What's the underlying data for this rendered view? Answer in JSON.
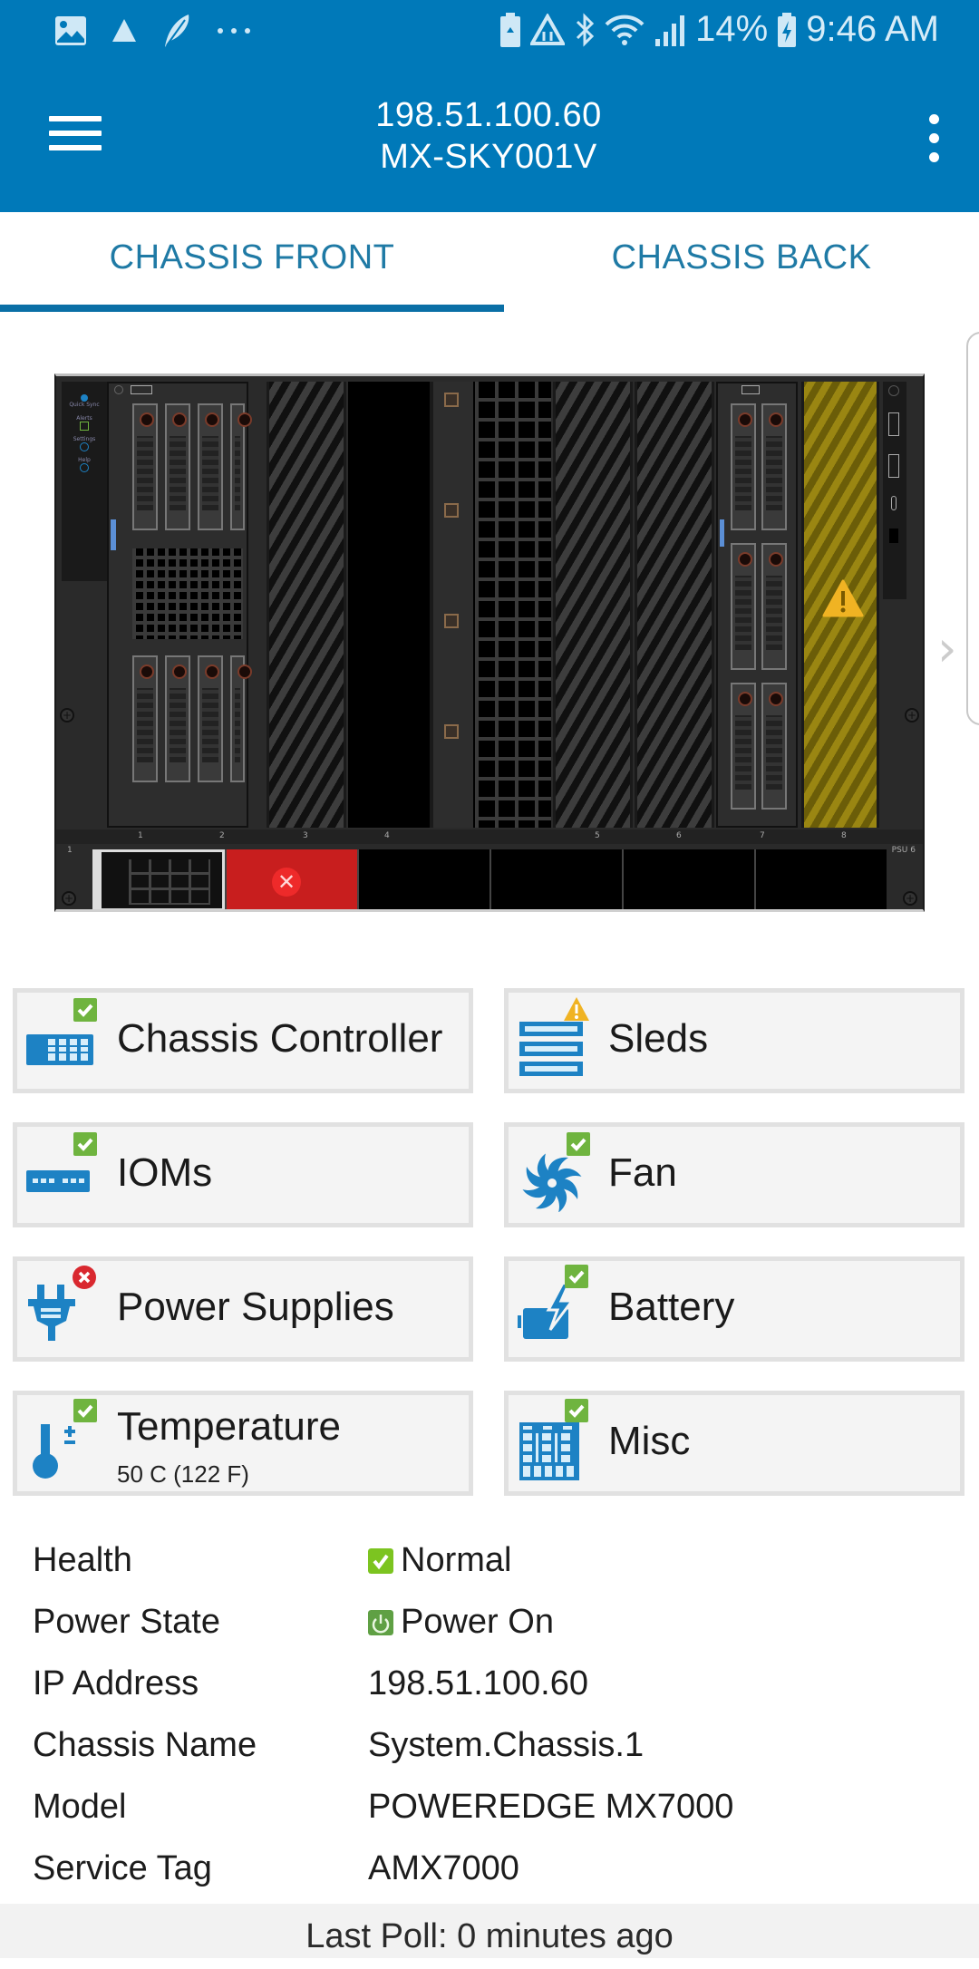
{
  "status_bar": {
    "left_icons": [
      "gallery-icon",
      "triangle-app-icon",
      "feather-icon",
      "more-notifications-icon"
    ],
    "right_icons": [
      "battery-saver-icon",
      "data-saver-icon",
      "bluetooth-icon",
      "wifi-icon",
      "signal-icon"
    ],
    "battery": "14%",
    "time": "9:46 AM"
  },
  "header": {
    "ip": "198.51.100.60",
    "name": "MX-SKY001V"
  },
  "tabs": [
    {
      "label": "CHASSIS FRONT",
      "active": true
    },
    {
      "label": "CHASSIS BACK",
      "active": false
    }
  ],
  "chassis_view": {
    "left_panel": [
      "Quick Sync",
      "Alerts",
      "Settings",
      "Help"
    ],
    "slot_labels": [
      "1",
      "2",
      "3",
      "4",
      "5",
      "6",
      "7",
      "8"
    ],
    "psu_labels": {
      "left": "1",
      "right": "PSU 6"
    },
    "sled_warning_slot": 8,
    "psu_error_slot": 2
  },
  "tiles": [
    {
      "label": "Chassis Controller",
      "status": "ok",
      "icon": "chassis-controller-icon"
    },
    {
      "label": "Sleds",
      "status": "warning",
      "icon": "sleds-icon"
    },
    {
      "label": "IOMs",
      "status": "ok",
      "icon": "iom-icon"
    },
    {
      "label": "Fan",
      "status": "ok",
      "icon": "fan-icon"
    },
    {
      "label": "Power Supplies",
      "status": "error",
      "icon": "power-plug-icon"
    },
    {
      "label": "Battery",
      "status": "ok",
      "icon": "battery-icon"
    },
    {
      "label": "Temperature",
      "sub": "50 C (122 F)",
      "status": "ok",
      "icon": "thermometer-icon"
    },
    {
      "label": "Misc",
      "status": "ok",
      "icon": "misc-icon"
    }
  ],
  "info": [
    {
      "label": "Health",
      "value": "Normal",
      "icon": "health-ok-icon"
    },
    {
      "label": "Power State",
      "value": "Power On",
      "icon": "power-on-icon"
    },
    {
      "label": "IP Address",
      "value": "198.51.100.60"
    },
    {
      "label": "Chassis Name",
      "value": "System.Chassis.1"
    },
    {
      "label": "Model",
      "value": "POWEREDGE MX7000"
    },
    {
      "label": "Service Tag",
      "value": "AMX7000"
    }
  ],
  "footer": {
    "text": "Last Poll: 0 minutes ago"
  },
  "colors": {
    "brand_blue": "#0079b9",
    "ok_green": "#6fb43f",
    "warning_amber": "#f0b323",
    "error_red": "#d9282f",
    "icon_blue": "#1d82c4"
  }
}
